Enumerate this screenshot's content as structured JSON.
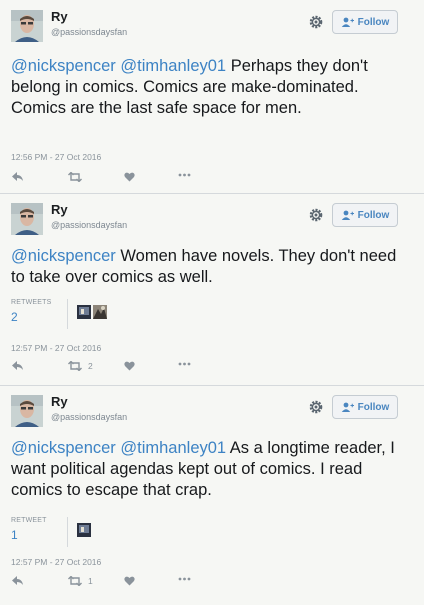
{
  "tweets": [
    {
      "name": "Ry",
      "handle": "@passionsdaysfan",
      "follow_label": "Follow",
      "mentions": [
        "@nickspencer",
        "@timhanley01"
      ],
      "body": " Perhaps they don't belong in comics. Comics are make-dominated. Comics are the last safe space for men.",
      "timestamp": "12:56 PM - 27 Oct 2016",
      "retweet_count": ""
    },
    {
      "name": "Ry",
      "handle": "@passionsdaysfan",
      "follow_label": "Follow",
      "mentions": [
        "@nickspencer"
      ],
      "body": " Women have novels. They don't need to take over comics as well.",
      "stats_label": "RETWEETS",
      "stats_value": "2",
      "timestamp": "12:57 PM - 27 Oct 2016",
      "retweet_count": "2"
    },
    {
      "name": "Ry",
      "handle": "@passionsdaysfan",
      "follow_label": "Follow",
      "mentions": [
        "@nickspencer",
        "@timhanley01"
      ],
      "body": " As a longtime reader, I want political agendas kept out of comics. I read comics to escape that crap.",
      "stats_label": "RETWEET",
      "stats_value": "1",
      "timestamp": "12:57 PM - 27 Oct 2016",
      "retweet_count": "1"
    }
  ],
  "icons": {
    "reply": "reply-icon",
    "retweet": "retweet-icon",
    "like": "heart-icon",
    "more": "more-icon",
    "gear": "gear-icon",
    "follow": "add-user-icon"
  },
  "colors": {
    "link": "#3d83c4",
    "muted": "#8a939b",
    "background": "#f6f7f4"
  }
}
